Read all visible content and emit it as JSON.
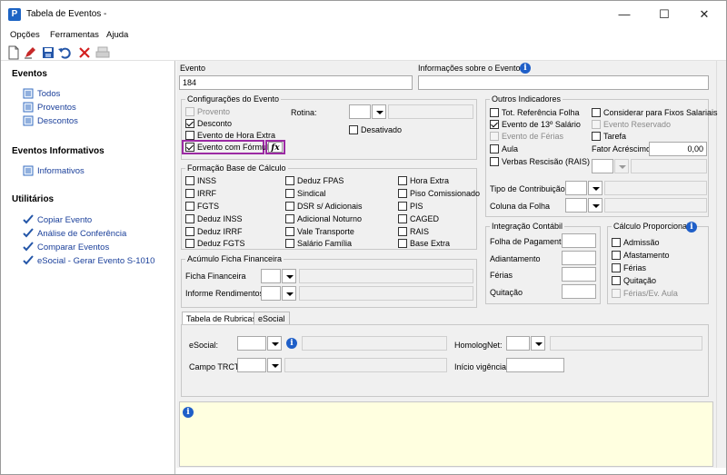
{
  "window": {
    "title": "Tabela de Eventos -",
    "app_icon": "P"
  },
  "menu": {
    "opcoes": "Opções",
    "ferramentas": "Ferramentas",
    "ajuda": "Ajuda"
  },
  "sidebar": {
    "eventos_header": "Eventos",
    "eventos": [
      "Todos",
      "Proventos",
      "Descontos"
    ],
    "informativos_header": "Eventos Informativos",
    "informativos": [
      "Informativos"
    ],
    "utilitarios_header": "Utilitários",
    "utilitarios": [
      "Copiar Evento",
      "Análise de Conferência",
      "Comparar Eventos",
      "eSocial - Gerar Evento S-1010"
    ]
  },
  "evento": {
    "label": "Evento",
    "value": "184",
    "info_label": "Informações sobre o Evento"
  },
  "config": {
    "title": "Configurações do Evento",
    "provento": "Provento",
    "desconto": "Desconto",
    "hora_extra": "Evento de Hora Extra",
    "formula": "Evento com Fórmula",
    "fx": "fx",
    "rotina": "Rotina:",
    "desativado": "Desativado"
  },
  "outros": {
    "title": "Outros Indicadores",
    "tot_ref": "Tot. Referência Folha",
    "salario13": "Evento de 13º Salário",
    "ferias": "Evento de Férias",
    "aula": "Aula",
    "verbas": "Verbas Rescisão (RAIS)",
    "fixos": "Considerar para Fixos Salariais",
    "reservado": "Evento Reservado",
    "tarefa": "Tarefa",
    "fator_label": "Fator Acréscimo",
    "fator_value": "0,00",
    "tipo_contrib": "Tipo de Contribuição",
    "coluna_folha": "Coluna da Folha"
  },
  "formacao": {
    "title": "Formação Base de Cálculo",
    "col1": [
      "INSS",
      "IRRF",
      "FGTS",
      "Deduz INSS",
      "Deduz IRRF",
      "Deduz FGTS"
    ],
    "col2": [
      "Deduz FPAS",
      "Sindical",
      "DSR s/ Adicionais",
      "Adicional Noturno",
      "Vale Transporte",
      "Salário Família"
    ],
    "col3": [
      "Hora Extra",
      "Piso Comissionado",
      "PIS",
      "CAGED",
      "RAIS",
      "Base Extra"
    ]
  },
  "acumulo": {
    "title": "Acúmulo Ficha Financeira",
    "ficha": "Ficha Financeira",
    "informe": "Informe Rendimentos"
  },
  "integracao": {
    "title": "Integração Contábil",
    "items": [
      "Folha de Pagamento",
      "Adiantamento",
      "Férias",
      "Quitação"
    ]
  },
  "calculo": {
    "title": "Cálculo Proporcional",
    "items": [
      "Admissão",
      "Afastamento",
      "Férias",
      "Quitação",
      "Férias/Ev. Aula"
    ]
  },
  "tabs": {
    "rubricas": "Tabela de Rubricas",
    "esocial": "eSocial"
  },
  "rubricas": {
    "esocial": "eSocial:",
    "homolognet": "HomologNet:",
    "campo_trct": "Campo TRCT:",
    "inicio": "Início vigência:"
  }
}
